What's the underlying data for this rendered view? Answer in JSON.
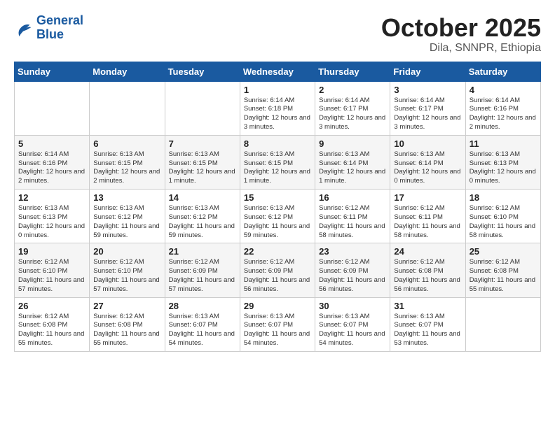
{
  "header": {
    "logo_line1": "General",
    "logo_line2": "Blue",
    "title": "October 2025",
    "subtitle": "Dila, SNNPR, Ethiopia"
  },
  "weekdays": [
    "Sunday",
    "Monday",
    "Tuesday",
    "Wednesday",
    "Thursday",
    "Friday",
    "Saturday"
  ],
  "weeks": [
    [
      {
        "day": "",
        "info": ""
      },
      {
        "day": "",
        "info": ""
      },
      {
        "day": "",
        "info": ""
      },
      {
        "day": "1",
        "info": "Sunrise: 6:14 AM\nSunset: 6:18 PM\nDaylight: 12 hours\nand 3 minutes."
      },
      {
        "day": "2",
        "info": "Sunrise: 6:14 AM\nSunset: 6:17 PM\nDaylight: 12 hours\nand 3 minutes."
      },
      {
        "day": "3",
        "info": "Sunrise: 6:14 AM\nSunset: 6:17 PM\nDaylight: 12 hours\nand 3 minutes."
      },
      {
        "day": "4",
        "info": "Sunrise: 6:14 AM\nSunset: 6:16 PM\nDaylight: 12 hours\nand 2 minutes."
      }
    ],
    [
      {
        "day": "5",
        "info": "Sunrise: 6:14 AM\nSunset: 6:16 PM\nDaylight: 12 hours\nand 2 minutes."
      },
      {
        "day": "6",
        "info": "Sunrise: 6:13 AM\nSunset: 6:15 PM\nDaylight: 12 hours\nand 2 minutes."
      },
      {
        "day": "7",
        "info": "Sunrise: 6:13 AM\nSunset: 6:15 PM\nDaylight: 12 hours\nand 1 minute."
      },
      {
        "day": "8",
        "info": "Sunrise: 6:13 AM\nSunset: 6:15 PM\nDaylight: 12 hours\nand 1 minute."
      },
      {
        "day": "9",
        "info": "Sunrise: 6:13 AM\nSunset: 6:14 PM\nDaylight: 12 hours\nand 1 minute."
      },
      {
        "day": "10",
        "info": "Sunrise: 6:13 AM\nSunset: 6:14 PM\nDaylight: 12 hours\nand 0 minutes."
      },
      {
        "day": "11",
        "info": "Sunrise: 6:13 AM\nSunset: 6:13 PM\nDaylight: 12 hours\nand 0 minutes."
      }
    ],
    [
      {
        "day": "12",
        "info": "Sunrise: 6:13 AM\nSunset: 6:13 PM\nDaylight: 12 hours\nand 0 minutes."
      },
      {
        "day": "13",
        "info": "Sunrise: 6:13 AM\nSunset: 6:12 PM\nDaylight: 11 hours\nand 59 minutes."
      },
      {
        "day": "14",
        "info": "Sunrise: 6:13 AM\nSunset: 6:12 PM\nDaylight: 11 hours\nand 59 minutes."
      },
      {
        "day": "15",
        "info": "Sunrise: 6:13 AM\nSunset: 6:12 PM\nDaylight: 11 hours\nand 59 minutes."
      },
      {
        "day": "16",
        "info": "Sunrise: 6:12 AM\nSunset: 6:11 PM\nDaylight: 11 hours\nand 58 minutes."
      },
      {
        "day": "17",
        "info": "Sunrise: 6:12 AM\nSunset: 6:11 PM\nDaylight: 11 hours\nand 58 minutes."
      },
      {
        "day": "18",
        "info": "Sunrise: 6:12 AM\nSunset: 6:10 PM\nDaylight: 11 hours\nand 58 minutes."
      }
    ],
    [
      {
        "day": "19",
        "info": "Sunrise: 6:12 AM\nSunset: 6:10 PM\nDaylight: 11 hours\nand 57 minutes."
      },
      {
        "day": "20",
        "info": "Sunrise: 6:12 AM\nSunset: 6:10 PM\nDaylight: 11 hours\nand 57 minutes."
      },
      {
        "day": "21",
        "info": "Sunrise: 6:12 AM\nSunset: 6:09 PM\nDaylight: 11 hours\nand 57 minutes."
      },
      {
        "day": "22",
        "info": "Sunrise: 6:12 AM\nSunset: 6:09 PM\nDaylight: 11 hours\nand 56 minutes."
      },
      {
        "day": "23",
        "info": "Sunrise: 6:12 AM\nSunset: 6:09 PM\nDaylight: 11 hours\nand 56 minutes."
      },
      {
        "day": "24",
        "info": "Sunrise: 6:12 AM\nSunset: 6:08 PM\nDaylight: 11 hours\nand 56 minutes."
      },
      {
        "day": "25",
        "info": "Sunrise: 6:12 AM\nSunset: 6:08 PM\nDaylight: 11 hours\nand 55 minutes."
      }
    ],
    [
      {
        "day": "26",
        "info": "Sunrise: 6:12 AM\nSunset: 6:08 PM\nDaylight: 11 hours\nand 55 minutes."
      },
      {
        "day": "27",
        "info": "Sunrise: 6:12 AM\nSunset: 6:08 PM\nDaylight: 11 hours\nand 55 minutes."
      },
      {
        "day": "28",
        "info": "Sunrise: 6:13 AM\nSunset: 6:07 PM\nDaylight: 11 hours\nand 54 minutes."
      },
      {
        "day": "29",
        "info": "Sunrise: 6:13 AM\nSunset: 6:07 PM\nDaylight: 11 hours\nand 54 minutes."
      },
      {
        "day": "30",
        "info": "Sunrise: 6:13 AM\nSunset: 6:07 PM\nDaylight: 11 hours\nand 54 minutes."
      },
      {
        "day": "31",
        "info": "Sunrise: 6:13 AM\nSunset: 6:07 PM\nDaylight: 11 hours\nand 53 minutes."
      },
      {
        "day": "",
        "info": ""
      }
    ]
  ]
}
